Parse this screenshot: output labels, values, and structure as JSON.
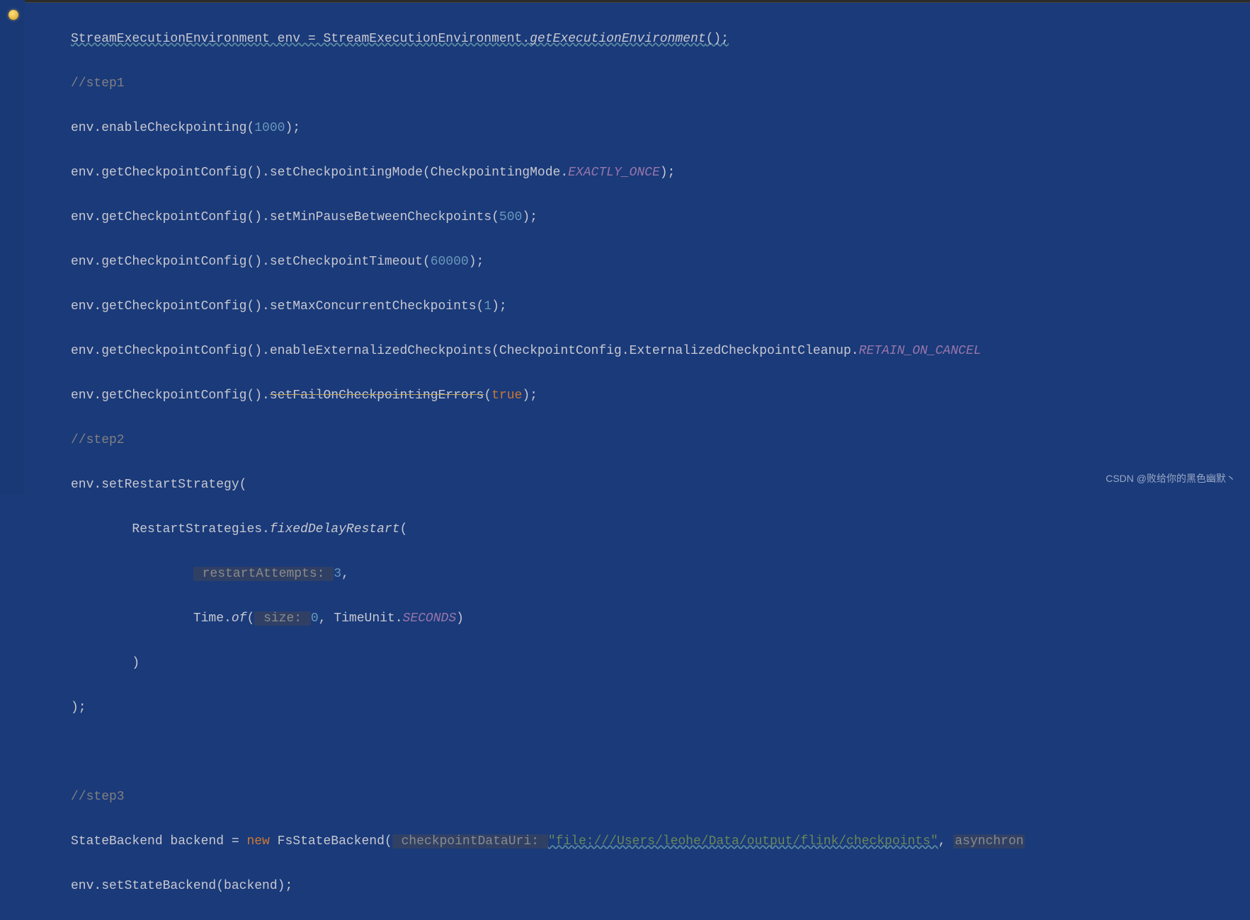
{
  "code": {
    "line0_pre": "StreamExecutionEnvironment env = StreamExecutionEnvironment.",
    "line0_method": "getExecutionEnvironment",
    "line0_post": "();",
    "c1": "//step1",
    "l2_a": "env.enableCheckpointing(",
    "l2_n": "1000",
    "l2_b": ");",
    "l3_a": "env.getCheckpointConfig().setCheckpointingMode(CheckpointingMode.",
    "l3_e": "EXACTLY_ONCE",
    "l3_b": ");",
    "l4_a": "env.getCheckpointConfig().setMinPauseBetweenCheckpoints(",
    "l4_n": "500",
    "l4_b": ");",
    "l5_a": "env.getCheckpointConfig().setCheckpointTimeout(",
    "l5_n": "60000",
    "l5_b": ");",
    "l6_a": "env.getCheckpointConfig().setMaxConcurrentCheckpoints(",
    "l6_n": "1",
    "l6_b": ");",
    "l7_a": "env.getCheckpointConfig().enableExternalizedCheckpoints(CheckpointConfig.ExternalizedCheckpointCleanup.",
    "l7_e": "RETAIN_ON_CANCEL",
    "l8_a": "env.getCheckpointConfig().",
    "l8_s": "setFailOnCheckpointingErrors",
    "l8_b": "(",
    "l8_k": "true",
    "l8_c": ");",
    "c2": "//step2",
    "l9": "env.setRestartStrategy(",
    "l10_a": "        RestartStrategies.",
    "l10_m": "fixedDelayRestart",
    "l10_b": "(",
    "l11_a": "                ",
    "l11_p": " restartAttempts: ",
    "l11_n": "3",
    "l11_b": ",",
    "l12_a": "                Time.",
    "l12_m": "of",
    "l12_b": "(",
    "l12_p": " size: ",
    "l12_n": "0",
    "l12_c": ", TimeUnit.",
    "l12_e": "SECONDS",
    "l12_d": ")",
    "l13": "        )",
    "l14": ");",
    "c3": "//step3",
    "l15_a": "StateBackend backend = ",
    "l15_k": "new",
    "l15_b": " FsStateBackend(",
    "l15_p": " checkpointDataUri: ",
    "l15_s": "\"file:///Users/leohe/Data/output/flink/checkpoints\"",
    "l15_c": ", ",
    "l15_p2": "asynchron",
    "l16": "env.setStateBackend(backend);"
  },
  "watermark": "CSDN @败给你的黑色幽默丶"
}
